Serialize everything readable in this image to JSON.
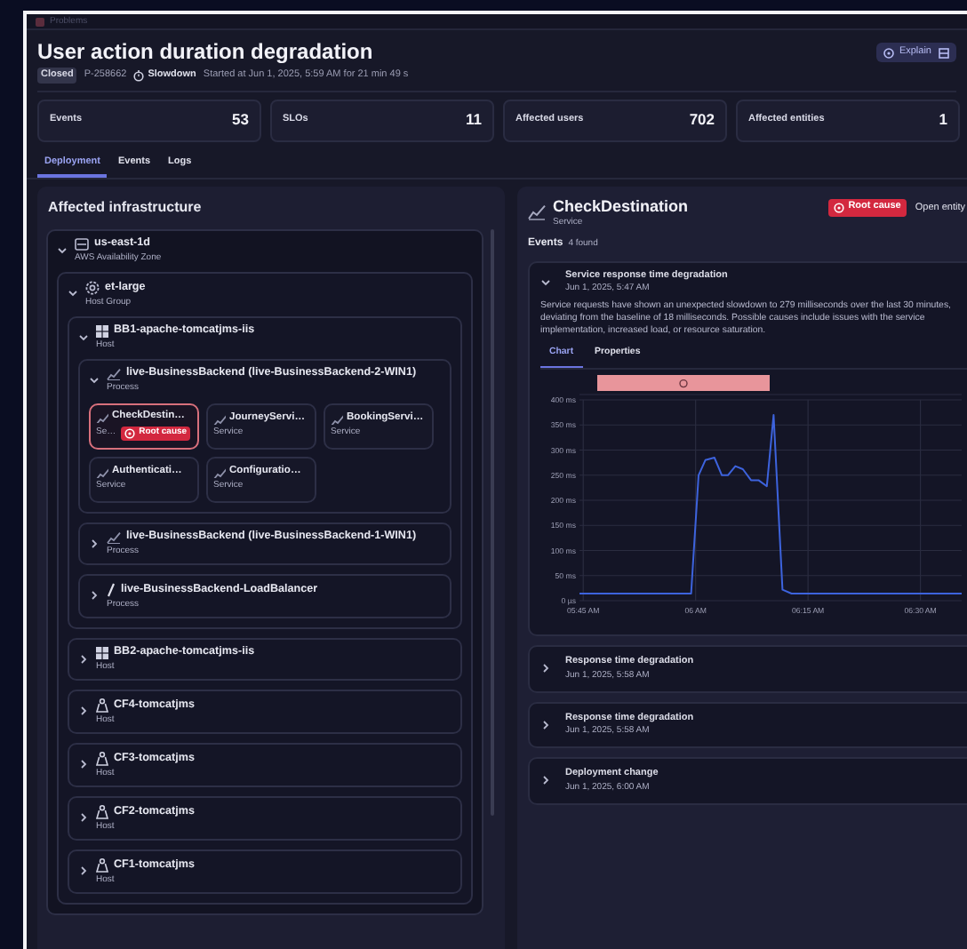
{
  "breadcrumb": "Problems",
  "title": "User action duration degradation",
  "explain_button": "Explain",
  "status": "Closed",
  "problem_id": "P-258662",
  "category": "Slowdown",
  "started": "Started at Jun 1, 2025, 5:59 AM for 21 min 49 s",
  "stats": [
    {
      "label": "Events",
      "value": "53"
    },
    {
      "label": "SLOs",
      "value": "11"
    },
    {
      "label": "Affected users",
      "value": "702"
    },
    {
      "label": "Affected entities",
      "value": "1"
    }
  ],
  "tabs": [
    {
      "label": "Deployment",
      "selected": true
    },
    {
      "label": "Events",
      "selected": false
    },
    {
      "label": "Logs",
      "selected": false
    }
  ],
  "infrastructure": {
    "title": "Affected infrastructure",
    "tree": [
      {
        "kind": "zone",
        "name": "us-east-1d",
        "type": "AWS Availability Zone",
        "expanded": true,
        "children": [
          {
            "kind": "hostgroup",
            "name": "et-large",
            "type": "Host Group",
            "expanded": true,
            "children": [
              {
                "kind": "windows",
                "name": "BB1-apache-tomcatjms-iis",
                "type": "Host",
                "expanded": true,
                "children": [
                  {
                    "kind": "process",
                    "name": "live-BusinessBackend (live-BusinessBackend-2-WIN1)",
                    "type": "Process",
                    "expanded": true,
                    "services": [
                      {
                        "name": "CheckDestin…",
                        "type": "Se…",
                        "badge": "Root cause",
                        "selected": true
                      },
                      {
                        "name": "JourneyServi…",
                        "type": "Service",
                        "selected": false
                      },
                      {
                        "name": "BookingServi…",
                        "type": "Service",
                        "selected": false
                      },
                      {
                        "name": "Authenticati…",
                        "type": "Service",
                        "selected": false
                      },
                      {
                        "name": "Configuratio…",
                        "type": "Service",
                        "selected": false
                      }
                    ]
                  },
                  {
                    "kind": "process",
                    "name": "live-BusinessBackend (live-BusinessBackend-1-WIN1)",
                    "type": "Process",
                    "expanded": false
                  },
                  {
                    "kind": "loadbalancer",
                    "name": "live-BusinessBackend-LoadBalancer",
                    "type": "Process",
                    "expanded": false
                  }
                ]
              },
              {
                "kind": "windows",
                "name": "BB2-apache-tomcatjms-iis",
                "type": "Host",
                "expanded": false
              },
              {
                "kind": "linux",
                "name": "CF4-tomcatjms",
                "type": "Host",
                "expanded": false
              },
              {
                "kind": "linux",
                "name": "CF3-tomcatjms",
                "type": "Host",
                "expanded": false
              },
              {
                "kind": "linux",
                "name": "CF2-tomcatjms",
                "type": "Host",
                "expanded": false
              },
              {
                "kind": "linux",
                "name": "CF1-tomcatjms",
                "type": "Host",
                "expanded": false
              }
            ]
          }
        ]
      }
    ]
  },
  "entity": {
    "name": "CheckDestination",
    "type": "Service",
    "badge": "Root cause",
    "open_link": "Open entity"
  },
  "events": {
    "label": "Events",
    "count": "4 found",
    "items": [
      {
        "title": "Service response time degradation",
        "time": "Jun 1, 2025, 5:47 AM",
        "expanded": true,
        "description": "Service requests have shown an unexpected slowdown to 279 milliseconds over the last 30 minutes, deviating from the baseline of 18 milliseconds. Possible causes include issues with the service implementation, increased load, or resource saturation.",
        "tabs": [
          {
            "label": "Chart",
            "selected": true
          },
          {
            "label": "Properties",
            "selected": false
          }
        ],
        "chart_data": {
          "type": "line",
          "x": [
            5.7417,
            5.99,
            6.0067,
            6.0217,
            6.0417,
            6.0583,
            6.0717,
            6.0883,
            6.105,
            6.1233,
            6.14,
            6.1583,
            6.1733,
            6.1933,
            6.2133,
            6.3333,
            6.45,
            6.5917
          ],
          "series": [
            {
              "color": "#3d63dd",
              "values": [
                14,
                14,
                250,
                280,
                285,
                250,
                250,
                268,
                262,
                240,
                240,
                228,
                370,
                22,
                14,
                14,
                14,
                14
              ]
            }
          ],
          "xlim": [
            5.7417,
            6.5917
          ],
          "ylim": [
            0,
            400
          ],
          "grid": true,
          "xticks": [
            {
              "value": 5.75,
              "label": "05:45 AM"
            },
            {
              "value": 6,
              "label": "06 AM"
            },
            {
              "value": 6.25,
              "label": "06:15 AM"
            },
            {
              "value": 6.5,
              "label": "06:30 AM"
            }
          ],
          "yticks": [
            {
              "value": 0,
              "label": "0 µs"
            },
            {
              "value": 50,
              "label": "50 ms"
            },
            {
              "value": 100,
              "label": "100 ms"
            },
            {
              "value": 150,
              "label": "150 ms"
            },
            {
              "value": 200,
              "label": "200 ms"
            },
            {
              "value": 250,
              "label": "250 ms"
            },
            {
              "value": 300,
              "label": "300 ms"
            },
            {
              "value": 350,
              "label": "350 ms"
            },
            {
              "value": 400,
              "label": "400 ms"
            }
          ]
        }
      },
      {
        "title": "Response time degradation",
        "time": "Jun 1, 2025, 5:58 AM",
        "expanded": false
      },
      {
        "title": "Response time degradation",
        "time": "Jun 1, 2025, 5:58 AM",
        "expanded": false
      },
      {
        "title": "Deployment change",
        "time": "Jun 1, 2025, 6:00 AM",
        "expanded": false
      }
    ]
  }
}
